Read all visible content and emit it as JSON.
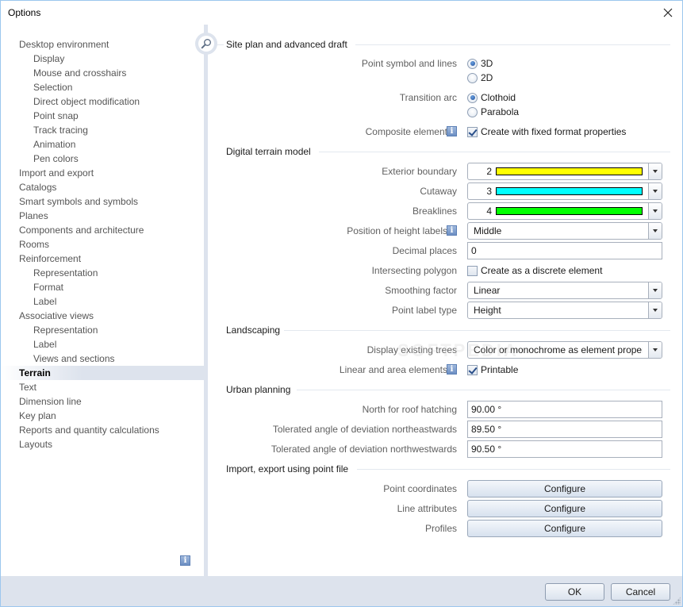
{
  "window": {
    "title": "Options",
    "close_icon": "close-icon"
  },
  "sidebar": {
    "items": [
      {
        "label": "Desktop environment",
        "level": 0
      },
      {
        "label": "Display",
        "level": 1
      },
      {
        "label": "Mouse and crosshairs",
        "level": 1
      },
      {
        "label": "Selection",
        "level": 1
      },
      {
        "label": "Direct object modification",
        "level": 1
      },
      {
        "label": "Point snap",
        "level": 1
      },
      {
        "label": "Track tracing",
        "level": 1
      },
      {
        "label": "Animation",
        "level": 1
      },
      {
        "label": "Pen colors",
        "level": 1
      },
      {
        "label": "Import and export",
        "level": 0
      },
      {
        "label": "Catalogs",
        "level": 0
      },
      {
        "label": "Smart symbols and symbols",
        "level": 0
      },
      {
        "label": "Planes",
        "level": 0
      },
      {
        "label": "Components and architecture",
        "level": 0
      },
      {
        "label": "Rooms",
        "level": 0
      },
      {
        "label": "Reinforcement",
        "level": 0
      },
      {
        "label": "Representation",
        "level": 1
      },
      {
        "label": "Format",
        "level": 1
      },
      {
        "label": "Label",
        "level": 1
      },
      {
        "label": "Associative views",
        "level": 0
      },
      {
        "label": "Representation",
        "level": 1
      },
      {
        "label": "Label",
        "level": 1
      },
      {
        "label": "Views and sections",
        "level": 1
      },
      {
        "label": "Terrain",
        "level": 0,
        "selected": true
      },
      {
        "label": "Text",
        "level": 0
      },
      {
        "label": "Dimension line",
        "level": 0
      },
      {
        "label": "Key plan",
        "level": 0
      },
      {
        "label": "Reports and quantity calculations",
        "level": 0
      },
      {
        "label": "Layouts",
        "level": 0
      }
    ],
    "info_icon": "info-icon",
    "info_glyph": "i"
  },
  "search": {
    "icon": "search-icon"
  },
  "groups": {
    "site_plan": {
      "title": "Site plan and advanced draft",
      "point_symbol_label": "Point symbol and lines",
      "point_symbol_options": [
        "3D",
        "2D"
      ],
      "point_symbol_selected": "3D",
      "transition_arc_label": "Transition arc",
      "transition_arc_options": [
        "Clothoid",
        "Parabola"
      ],
      "transition_arc_selected": "Clothoid",
      "composite_label": "Composite element",
      "composite_check_label": "Create with fixed format properties",
      "composite_checked": true
    },
    "dtm": {
      "title": "Digital terrain model",
      "exterior_boundary_label": "Exterior boundary",
      "exterior_boundary_value": "2",
      "exterior_boundary_color": "#ffff00",
      "cutaway_label": "Cutaway",
      "cutaway_value": "3",
      "cutaway_color": "#00ffff",
      "breaklines_label": "Breaklines",
      "breaklines_value": "4",
      "breaklines_color": "#00ff00",
      "height_labels_label": "Position of height labels",
      "height_labels_value": "Middle",
      "decimal_places_label": "Decimal places",
      "decimal_places_value": "0",
      "intersecting_label": "Intersecting polygon",
      "intersecting_check_label": "Create as a discrete element",
      "intersecting_checked": false,
      "smoothing_label": "Smoothing factor",
      "smoothing_value": "Linear",
      "point_label_type_label": "Point label type",
      "point_label_type_value": "Height"
    },
    "landscaping": {
      "title": "Landscaping",
      "trees_label": "Display existing trees",
      "trees_value": "Color or monochrome as element proper",
      "linear_label": "Linear and area elements",
      "linear_check_label": "Printable",
      "linear_checked": true
    },
    "urban": {
      "title": "Urban planning",
      "north_label": "North for roof hatching",
      "north_value": "90.00 °",
      "ne_label": "Tolerated angle of deviation northeastwards",
      "ne_value": "89.50 °",
      "nw_label": "Tolerated angle of deviation northwestwards",
      "nw_value": "90.50 °"
    },
    "point_file": {
      "title": "Import, export using point file",
      "coords_label": "Point coordinates",
      "line_attr_label": "Line attributes",
      "profiles_label": "Profiles",
      "configure_label": "Configure"
    }
  },
  "footer": {
    "ok_label": "OK",
    "cancel_label": "Cancel"
  },
  "watermark": "SOFTPEDIA"
}
